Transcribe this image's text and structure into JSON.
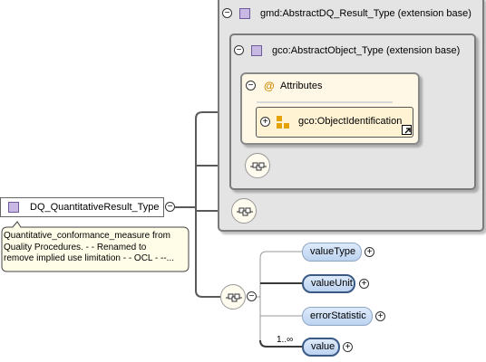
{
  "root": {
    "name": "DQ_QuantitativeResult_Type",
    "toggle": "−",
    "doc": [
      "Quantitative_conformance_measure from",
      "Quality Procedures. - - Renamed to",
      "remove implied use limitation - - OCL - --..."
    ]
  },
  "base1": {
    "name": "gmd:AbstractDQ_Result_Type (extension base)",
    "toggle": "−"
  },
  "base2": {
    "name": "gco:AbstractObject_Type (extension base)",
    "toggle": "−"
  },
  "attributes": {
    "label": "Attributes",
    "toggle": "−",
    "at": "@"
  },
  "attr_group": {
    "name": "gco:ObjectIdentification",
    "toggle": "+"
  },
  "elements": [
    {
      "label": "valueType",
      "toggle": "+"
    },
    {
      "label": "valueUnit",
      "toggle": "+"
    },
    {
      "label": "errorStatistic",
      "toggle": "+"
    },
    {
      "label": "value",
      "toggle": "+",
      "cardinality": "1..∞"
    }
  ],
  "seq_toggle": "−",
  "colors": {
    "outer_box": "#e4e4e4",
    "attr_box": "#fff8e6",
    "element_fill": "#c9dcf4",
    "connector": "#5a5a5a"
  }
}
